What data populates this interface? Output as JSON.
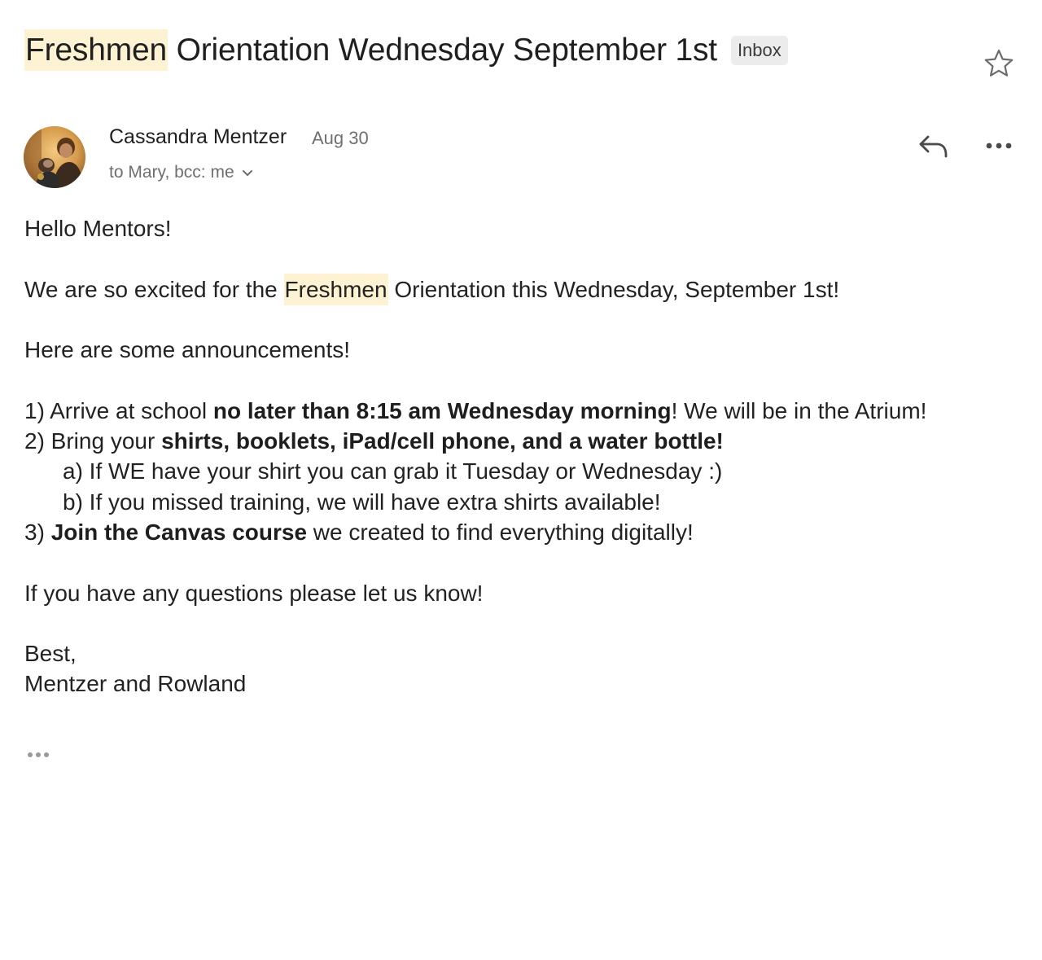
{
  "subject": {
    "highlight": "Freshmen",
    "rest": " Orientation Wednesday September 1st",
    "label": "Inbox"
  },
  "icons": {
    "star": "star-icon",
    "reply": "reply-icon",
    "more": "more-horizontal-icon",
    "chevron": "chevron-down-icon",
    "trimmed": "ellipsis-icon"
  },
  "sender": {
    "name": "Cassandra Mentzer",
    "date": "Aug 30",
    "recipients": "to Mary, bcc: me"
  },
  "body": {
    "greeting": "Hello Mentors!",
    "intro_pre": "We are so excited for the ",
    "intro_highlight": "Freshmen",
    "intro_post": " Orientation this Wednesday, September 1st!",
    "announce_heading": "Here are some announcements!",
    "item1_pre": "1) Arrive at school ",
    "item1_bold": "no later than 8:15 am Wednesday morning",
    "item1_post": "! We will be in the Atrium!",
    "item2_pre": "2) Bring your ",
    "item2_bold": "shirts, booklets, iPad/cell phone, and a water bottle!",
    "item2a": "a) If WE have your shirt you can grab it Tuesday or Wednesday :)",
    "item2b": "b) If you missed training, we will have extra shirts available!",
    "item3_pre": "3) ",
    "item3_bold": "Join the Canvas course",
    "item3_post": " we created to find everything digitally!",
    "questions": "If you have any questions please let us know!",
    "signoff": "Best,",
    "signature": "Mentzer and Rowland"
  },
  "colors": {
    "highlight": "#fdf3d2",
    "badge_bg": "#ececec",
    "muted_text": "#6f6f6f",
    "icon_gray": "#5f6368"
  }
}
